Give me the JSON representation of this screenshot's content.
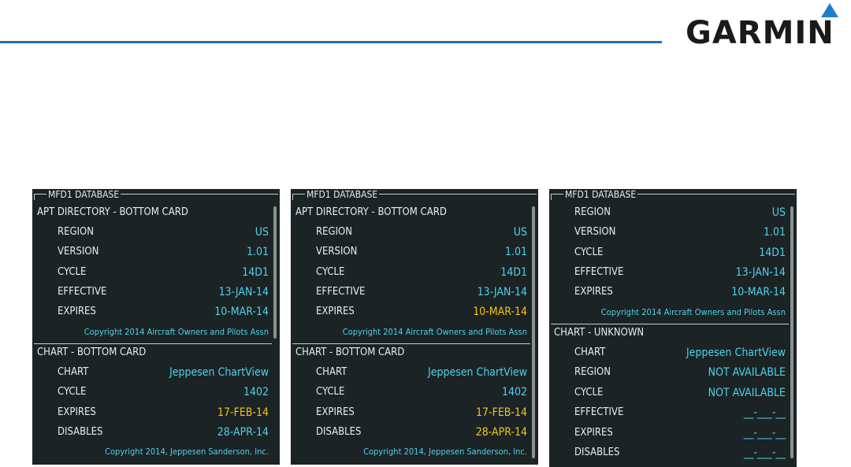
{
  "brand": {
    "name": "GARMIN",
    "accent": "#1f6fb6"
  },
  "colors": {
    "label": "#e8ecec",
    "value_cyan": "#4fd1e8",
    "value_yellow": "#f3c614",
    "panel_bg": "#1b2325"
  },
  "panels": [
    {
      "title": "MFD1 DATABASE",
      "apt_header": "APT DIRECTORY - BOTTOM CARD",
      "apt_rows": [
        {
          "label": "REGION",
          "value": "US"
        },
        {
          "label": "VERSION",
          "value": "1.01"
        },
        {
          "label": "CYCLE",
          "value": "14D1"
        },
        {
          "label": "EFFECTIVE",
          "value": "13-JAN-14"
        },
        {
          "label": "EXPIRES",
          "value": "10-MAR-14"
        }
      ],
      "apt_copyright": "Copyright 2014 Aircraft Owners and Pilots Assn",
      "chart_header": "CHART - BOTTOM CARD",
      "chart_rows": [
        {
          "label": "CHART",
          "value": "Jeppesen ChartView"
        },
        {
          "label": "CYCLE",
          "value": "1402"
        },
        {
          "label": "EXPIRES",
          "value": "17-FEB-14"
        },
        {
          "label": "DISABLES",
          "value": "28-APR-14"
        }
      ],
      "chart_copyright": "Copyright 2014, Jeppesen Sanderson, Inc."
    },
    {
      "title": "MFD1 DATABASE",
      "apt_header": "APT DIRECTORY - BOTTOM CARD",
      "apt_rows": [
        {
          "label": "REGION",
          "value": "US"
        },
        {
          "label": "VERSION",
          "value": "1.01"
        },
        {
          "label": "CYCLE",
          "value": "14D1"
        },
        {
          "label": "EFFECTIVE",
          "value": "13-JAN-14"
        },
        {
          "label": "EXPIRES",
          "value": "10-MAR-14"
        }
      ],
      "apt_copyright": "Copyright 2014 Aircraft Owners and Pilots Assn",
      "chart_header": "CHART - BOTTOM CARD",
      "chart_rows": [
        {
          "label": "CHART",
          "value": "Jeppesen ChartView"
        },
        {
          "label": "CYCLE",
          "value": "1402"
        },
        {
          "label": "EXPIRES",
          "value": "17-FEB-14"
        },
        {
          "label": "DISABLES",
          "value": "28-APR-14"
        }
      ],
      "chart_copyright": "Copyright 2014, Jeppesen Sanderson, Inc."
    },
    {
      "title": "MFD1 DATABASE",
      "apt_rows": [
        {
          "label": "REGION",
          "value": "US"
        },
        {
          "label": "VERSION",
          "value": "1.01"
        },
        {
          "label": "CYCLE",
          "value": "14D1"
        },
        {
          "label": "EFFECTIVE",
          "value": "13-JAN-14"
        },
        {
          "label": "EXPIRES",
          "value": "10-MAR-14"
        }
      ],
      "apt_copyright": "Copyright 2014 Aircraft Owners and Pilots Assn",
      "chart_header": "CHART - UNKNOWN",
      "chart_rows": [
        {
          "label": "CHART",
          "value": "Jeppesen ChartView"
        },
        {
          "label": "REGION",
          "value": "NOT AVAILABLE"
        },
        {
          "label": "CYCLE",
          "value": "NOT AVAILABLE"
        },
        {
          "label": "EFFECTIVE",
          "value": "__-___-__"
        },
        {
          "label": "EXPIRES",
          "value": "__-___-__"
        },
        {
          "label": "DISABLES",
          "value": "__-___-__"
        }
      ]
    }
  ]
}
